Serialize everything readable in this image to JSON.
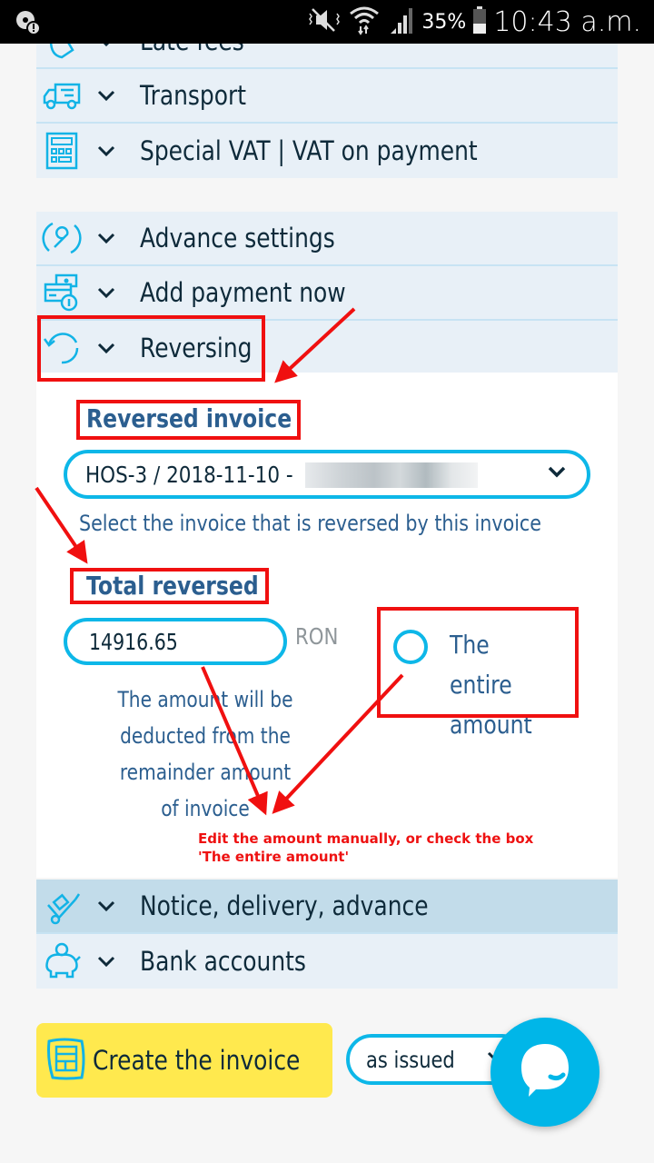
{
  "status_bar": {
    "battery_percent": "35%",
    "time": "10:43 a.m.",
    "icons": [
      "notification-alert-icon",
      "mute-vibrate-icon",
      "wifi-icon",
      "signal-icon",
      "battery-icon"
    ]
  },
  "sections_top": [
    {
      "label": "Late fees",
      "icon": "late-fees-icon"
    },
    {
      "label": "Transport",
      "icon": "truck-icon"
    },
    {
      "label": "Special VAT | VAT on payment",
      "icon": "calculator-icon"
    }
  ],
  "sections_mid": [
    {
      "label": "Advance settings",
      "icon": "wrench-icon"
    },
    {
      "label": "Add payment now",
      "icon": "card-payment-icon"
    },
    {
      "label": "Reversing",
      "icon": "reverse-icon"
    }
  ],
  "reversing": {
    "reversed_invoice_label": "Reversed invoice",
    "reversed_invoice_value": "HOS-3 / 2018-11-10 -",
    "reversed_invoice_help": "Select the invoice that is reversed by this invoice",
    "total_reversed_label": "Total reversed",
    "total_reversed_value": "14916.65",
    "currency": "RON",
    "entire_amount_label": "The entire amount",
    "entire_amount_checked": false,
    "note": "The amount will be deducted from the remainder amount of invoice"
  },
  "annotation": {
    "line1": "Edit the amount manually, or check the box",
    "line2": "'The entire amount'",
    "color": "#ee1111"
  },
  "sections_bottom": [
    {
      "label": "Notice, delivery, advance",
      "icon": "hand-truck-icon"
    },
    {
      "label": "Bank accounts",
      "icon": "piggy-bank-icon"
    }
  ],
  "footer": {
    "create_label": "Create the invoice",
    "issue_mode": "as issued"
  },
  "colors": {
    "accent": "#0db7e8",
    "create_button": "#ffe94e",
    "label_blue": "#2b5e8f",
    "panel_bg": "#e8f0f7"
  }
}
